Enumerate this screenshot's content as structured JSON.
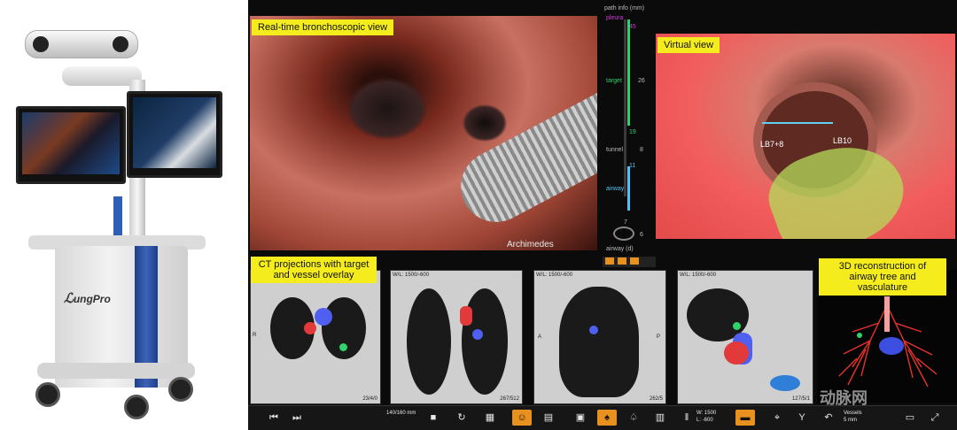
{
  "device": {
    "brand_label": "ungPro"
  },
  "labels": {
    "endoscopic": "Real-time bronchoscopic view",
    "virtual": "Virtual view",
    "ct": "CT projections with target and vessel overlay",
    "recon": "3D reconstruction of airway tree and vasculature"
  },
  "endoscope": {
    "brand": "Archimedes"
  },
  "path_info": {
    "title": "path info (mm)",
    "pleura": "pleura",
    "pleura_val": "45",
    "target": "target",
    "target_val": "26",
    "val_19": "19",
    "tunnel": "tunnel",
    "tunnel_val": "8",
    "val_11": "11",
    "airway": "airway",
    "airway_d": "airway (d)",
    "num_7": "7",
    "num_6": "6"
  },
  "virtual_view": {
    "branch_a": "LB7+8",
    "branch_b": "LB10"
  },
  "ct_panels": {
    "axial_foot": "23/4/0",
    "coronal_head": "W/L: 1500/-600",
    "coronal_foot": "267/512",
    "sagittal_head": "W/L: 1500/-600",
    "sagittal_foot": "262/5",
    "oblique_head": "W/L: 1500/-600",
    "oblique_foot": "127/5/1",
    "sag_label_a": "A",
    "sag_label_p": "P",
    "axial_label": "R"
  },
  "toolbar": {
    "prev_icon": "⏮",
    "next_icon": "⏭",
    "scale_text": "140/160 mm",
    "wl_text_1": "W: 1500",
    "wl_text_2": "L: -600",
    "voxels_1": "Vessels",
    "voxels_2": "5 mm"
  },
  "watermark": "动脉网",
  "colors": {
    "label_bg": "#f4ec1d",
    "active_tool": "#e8911e",
    "pleura": "#d13ad8",
    "target": "#2fd36a",
    "airway": "#4fc3f7"
  }
}
